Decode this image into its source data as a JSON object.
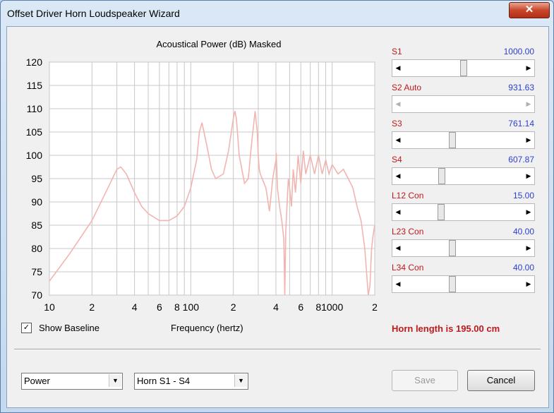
{
  "window": {
    "title": "Offset Driver Horn Loudspeaker Wizard",
    "close_glyph": "✕"
  },
  "chart": {
    "heading": "Acoustical Power (dB)   Masked",
    "xlabel": "Frequency (hertz)"
  },
  "chart_data": {
    "type": "line",
    "title": "Acoustical Power (dB)   Masked",
    "xlabel": "Frequency (hertz)",
    "ylabel": "",
    "x_scale": "log",
    "xlim": [
      10,
      2000
    ],
    "ylim": [
      70,
      120
    ],
    "y_ticks": [
      "120",
      "115",
      "110",
      "105",
      "100",
      "95",
      "90",
      "85",
      "80",
      "75",
      "70"
    ],
    "x_ticks": [
      "10",
      "2",
      "4",
      "6",
      "8",
      "100",
      "2",
      "4",
      "6",
      "8",
      "1000",
      "2"
    ],
    "grid": true,
    "series": [
      {
        "color": "#f3b4b0",
        "x": [
          10,
          14,
          20,
          25,
          30,
          32,
          35,
          40,
          45,
          50,
          60,
          70,
          80,
          90,
          100,
          110,
          115,
          120,
          130,
          140,
          150,
          170,
          185,
          200,
          205,
          210,
          215,
          220,
          240,
          255,
          270,
          285,
          295,
          300,
          305,
          310,
          320,
          340,
          360,
          380,
          400,
          402,
          410,
          425,
          440,
          455,
          462,
          470,
          490,
          500,
          515,
          530,
          550,
          575,
          600,
          625,
          650,
          700,
          750,
          800,
          850,
          900,
          950,
          1000,
          1100,
          1200,
          1300,
          1400,
          1500,
          1600,
          1700,
          1800,
          1850,
          1900,
          1950,
          2000
        ],
        "y": [
          73,
          79,
          86,
          92,
          97,
          97.5,
          96,
          92,
          89,
          87.5,
          86,
          86,
          87,
          89,
          93,
          99,
          105,
          107,
          102,
          97,
          95,
          96,
          101,
          108,
          109.5,
          108,
          104,
          100,
          94,
          95,
          103,
          109.5,
          105,
          100,
          97,
          96,
          95,
          93,
          88,
          95,
          99,
          100.5,
          93,
          89,
          86,
          82,
          70,
          84,
          95,
          93,
          89,
          97,
          92,
          100,
          94,
          101,
          96,
          100,
          96,
          100,
          96,
          99,
          96,
          98,
          96,
          97,
          95,
          93,
          89,
          86,
          80,
          70,
          72,
          80,
          83,
          85
        ]
      }
    ]
  },
  "sliders": [
    {
      "label": "S1",
      "value": "1000.00",
      "position": 0.5,
      "disabled": false
    },
    {
      "label": "S2  Auto",
      "value": "931.63",
      "position": null,
      "disabled": true
    },
    {
      "label": "S3",
      "value": "761.14",
      "position": 0.4,
      "disabled": false
    },
    {
      "label": "S4",
      "value": "607.87",
      "position": 0.31,
      "disabled": false
    },
    {
      "label": "L12  Con",
      "value": "15.00",
      "position": 0.3,
      "disabled": false
    },
    {
      "label": "L23  Con",
      "value": "40.00",
      "position": 0.4,
      "disabled": false
    },
    {
      "label": "L34  Con",
      "value": "40.00",
      "position": 0.4,
      "disabled": false
    }
  ],
  "baseline": {
    "label": "Show Baseline",
    "checked": true,
    "check_glyph": "✓"
  },
  "horn_length": "Horn length is 195.00 cm",
  "combo_mode": {
    "value": "Power"
  },
  "combo_range": {
    "value": "Horn S1 - S4"
  },
  "buttons": {
    "save": "Save",
    "cancel": "Cancel"
  },
  "colors": {
    "label_red": "#c0181b",
    "value_blue": "#2b3fd0",
    "curve": "#f3b4b0",
    "grid": "#c8c8c8"
  }
}
